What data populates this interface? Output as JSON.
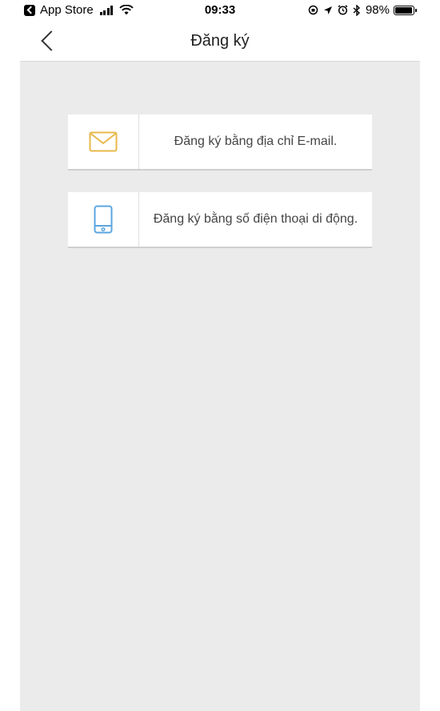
{
  "status_bar": {
    "app_back_label": "App Store",
    "time": "09:33",
    "battery": "98%",
    "battery_level": 0.98
  },
  "nav": {
    "title": "Đăng ký"
  },
  "options": [
    {
      "label": "Đăng ký bằng địa chỉ E-mail.",
      "icon": "envelope-icon",
      "icon_color": "#e8b84a"
    },
    {
      "label": "Đăng ký bằng số điện thoại di động.",
      "icon": "mobile-phone-icon",
      "icon_color": "#5aa6e0"
    }
  ],
  "colors": {
    "background": "#ebebeb",
    "card": "#ffffff",
    "text": "#444444"
  }
}
